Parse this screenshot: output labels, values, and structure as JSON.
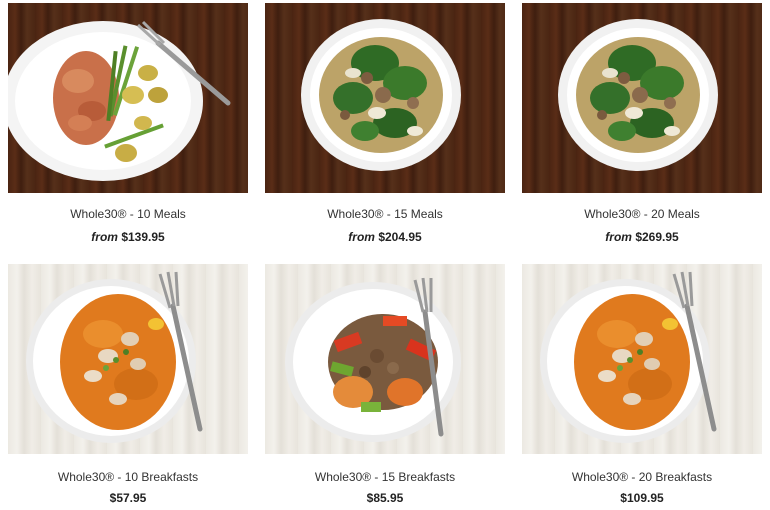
{
  "products": [
    {
      "title": "Whole30® - 10 Meals",
      "price_prefix": "from",
      "price": "$139.95",
      "image": "dinner-plate-chicken-greenbeans-potatoes"
    },
    {
      "title": "Whole30® - 15 Meals",
      "price_prefix": "from",
      "price": "$204.95",
      "image": "soup-bowl-greens-sausage"
    },
    {
      "title": "Whole30® - 20 Meals",
      "price_prefix": "from",
      "price": "$269.95",
      "image": "soup-bowl-greens-sausage"
    },
    {
      "title": "Whole30® - 10 Breakfasts",
      "price_prefix": "",
      "price": "$57.95",
      "image": "breakfast-plate-sweet-potato-chicken"
    },
    {
      "title": "Whole30® - 15 Breakfasts",
      "price_prefix": "",
      "price": "$85.95",
      "image": "breakfast-plate-sausage-peppers"
    },
    {
      "title": "Whole30® - 20 Breakfasts",
      "price_prefix": "",
      "price": "$109.95",
      "image": "breakfast-plate-sweet-potato-chicken"
    }
  ]
}
